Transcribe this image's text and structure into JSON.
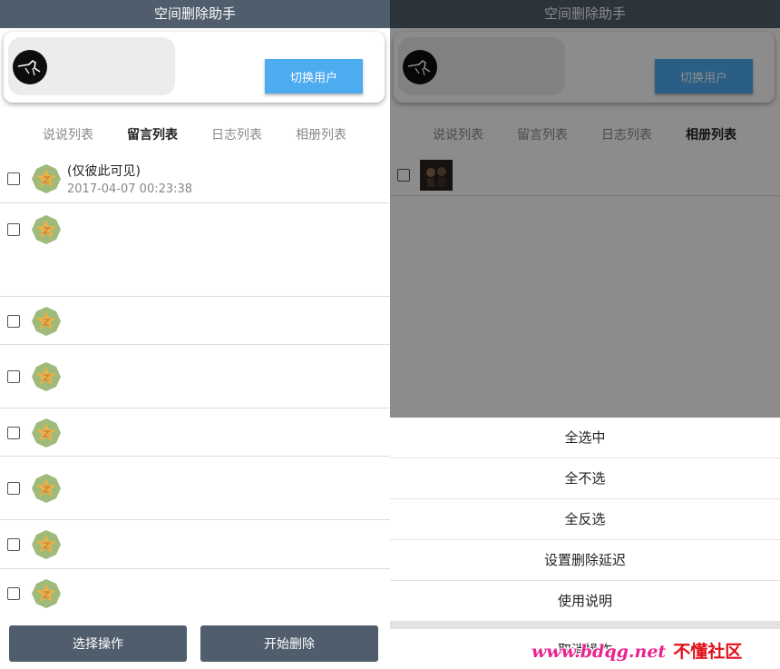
{
  "app": {
    "title": "空间删除助手"
  },
  "user": {
    "switch_label": "切换用户"
  },
  "tabs": [
    "说说列表",
    "留言列表",
    "日志列表",
    "相册列表"
  ],
  "left_active_tab": 1,
  "right_active_tab": 3,
  "messages": [
    {
      "title": "(仅彼此可见)",
      "time": "2017-04-07 00:23:38"
    },
    {
      "title": "",
      "time": ""
    },
    {
      "title": "",
      "time": ""
    },
    {
      "title": "",
      "time": ""
    },
    {
      "title": "",
      "time": ""
    },
    {
      "title": "",
      "time": ""
    },
    {
      "title": "",
      "time": ""
    },
    {
      "title": "",
      "time": ""
    }
  ],
  "bottom": {
    "select_label": "选择操作",
    "start_label": "开始删除"
  },
  "action_sheet": {
    "items": [
      "全选中",
      "全不选",
      "全反选",
      "设置删除延迟",
      "使用说明"
    ],
    "cancel": "取消操作"
  },
  "watermark": {
    "url": "www.bdqg.net",
    "name": "不懂社区"
  },
  "colors": {
    "titlebar": "#4f5d6c",
    "accent_blue": "#4dabf0",
    "button_dark": "#4f5d6c",
    "star": "#e7b24a",
    "badge_green": "#9fba7a"
  },
  "icons": {
    "avatar": "avatar-icon",
    "row": "star-badge-icon",
    "checkbox": "checkbox-icon"
  }
}
